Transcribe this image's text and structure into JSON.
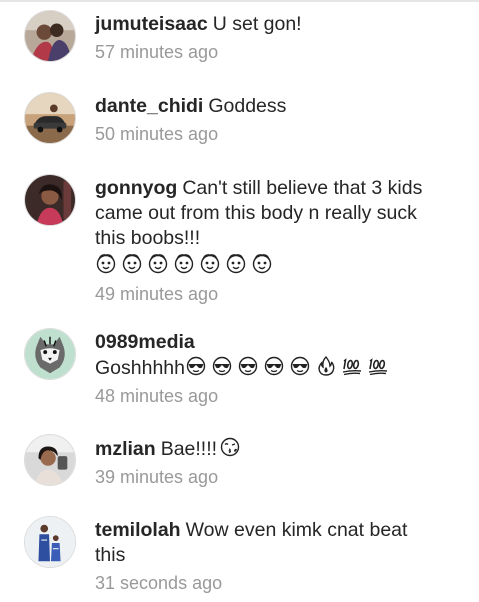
{
  "comments": [
    {
      "username": "jumuteisaac",
      "text": "U set gon!",
      "time": "57 minutes ago",
      "avatar_icon": "profile-photo-couple-icon"
    },
    {
      "username": "dante_chidi",
      "text": "Goddess",
      "time": "50 minutes ago",
      "avatar_icon": "profile-photo-car-icon"
    },
    {
      "username": "gonnyog",
      "text": "Can't still believe that 3 kids came out from this body n really suck this boobs!!!",
      "emojis": [
        "baby-face-icon",
        "baby-face-icon",
        "baby-face-icon",
        "baby-face-icon",
        "baby-face-icon",
        "baby-face-icon",
        "baby-face-icon"
      ],
      "time": "49 minutes ago",
      "avatar_icon": "profile-photo-woman-icon"
    },
    {
      "username": "0989media",
      "text": "Goshhhhh",
      "emojis": [
        "sunglasses-face-icon",
        "sunglasses-face-icon",
        "sunglasses-face-icon",
        "sunglasses-face-icon",
        "sunglasses-face-icon",
        "fire-icon",
        "hundred-points-icon",
        "hundred-points-icon"
      ],
      "time": "48 minutes ago",
      "avatar_icon": "profile-photo-tiger-icon"
    },
    {
      "username": "mzlian",
      "text": "Bae!!!!",
      "emojis": [
        "kissing-face-icon"
      ],
      "time": "39 minutes ago",
      "avatar_icon": "profile-photo-selfie-icon"
    },
    {
      "username": "temilolah",
      "text": "Wow even kimk cnat beat this",
      "time": "31 seconds ago",
      "avatar_icon": "profile-photo-family-icon"
    }
  ]
}
